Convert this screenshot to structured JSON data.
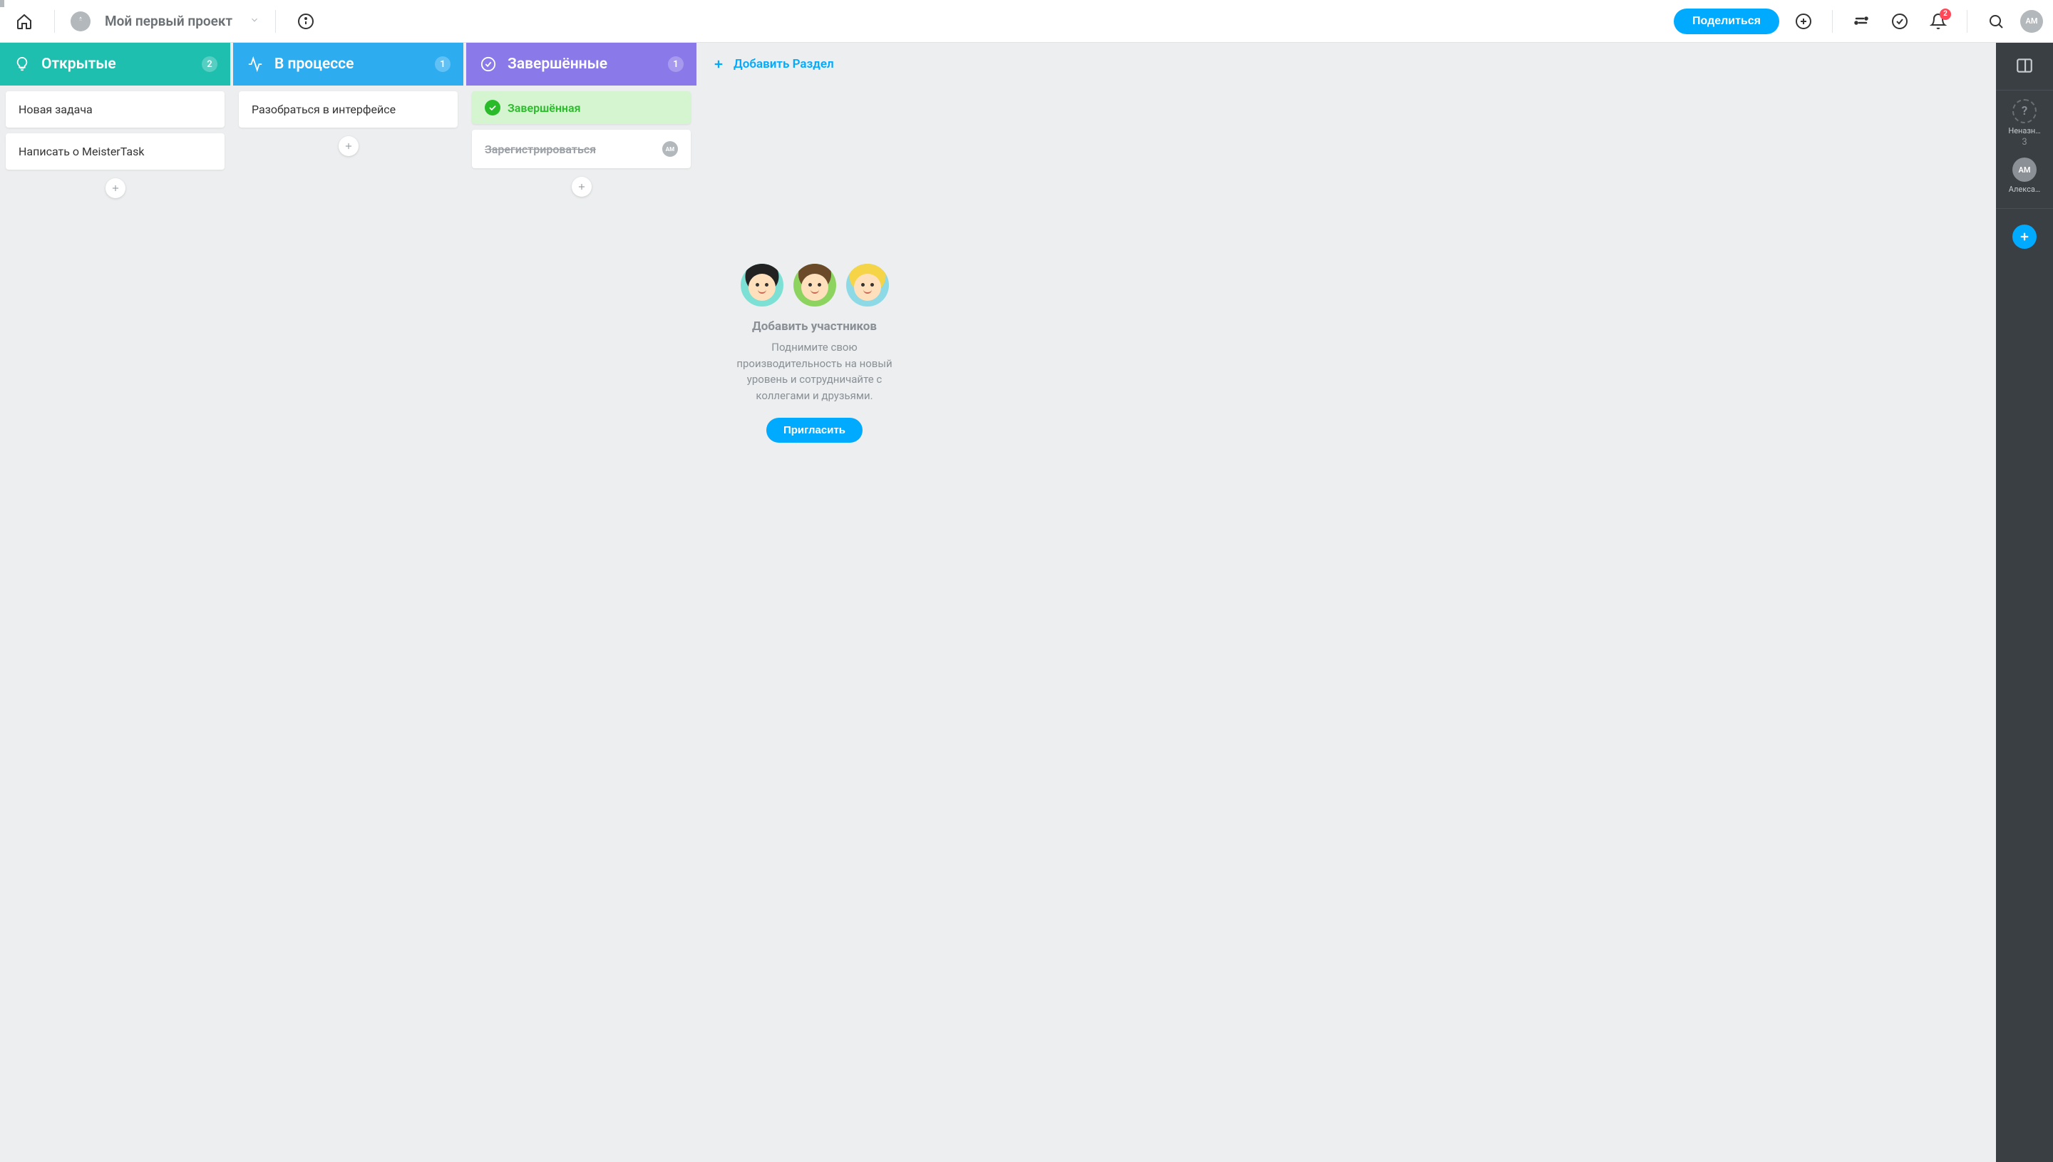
{
  "header": {
    "project_name": "Мой первый проект",
    "share_label": "Поделиться",
    "notification_count": "2",
    "user_initials": "АМ"
  },
  "columns": [
    {
      "id": "open",
      "title": "Открытые",
      "count": "2",
      "cards": [
        {
          "text": "Новая задача"
        },
        {
          "text": "Написать о MeisterTask"
        }
      ]
    },
    {
      "id": "progress",
      "title": "В процессе",
      "count": "1",
      "cards": [
        {
          "text": "Разобраться в интерфейсе"
        }
      ]
    },
    {
      "id": "done",
      "title": "Завершённые",
      "count": "1",
      "banner": "Завершённая",
      "cards": [
        {
          "text": "Зарегистрироваться",
          "assignee": "АМ",
          "completed": true
        }
      ]
    }
  ],
  "add_section_label": "Добавить Раздел",
  "invite": {
    "title": "Добавить участников",
    "desc": "Поднимите свою производительность на новый уровень и сотрудничайте с коллегами и друзьями.",
    "button": "Пригласить"
  },
  "sidebar": {
    "unassigned_label": "Неназн…",
    "unassigned_count": "3",
    "unassigned_symbol": "?",
    "member_label": "Алекса…",
    "member_initials": "АМ"
  }
}
